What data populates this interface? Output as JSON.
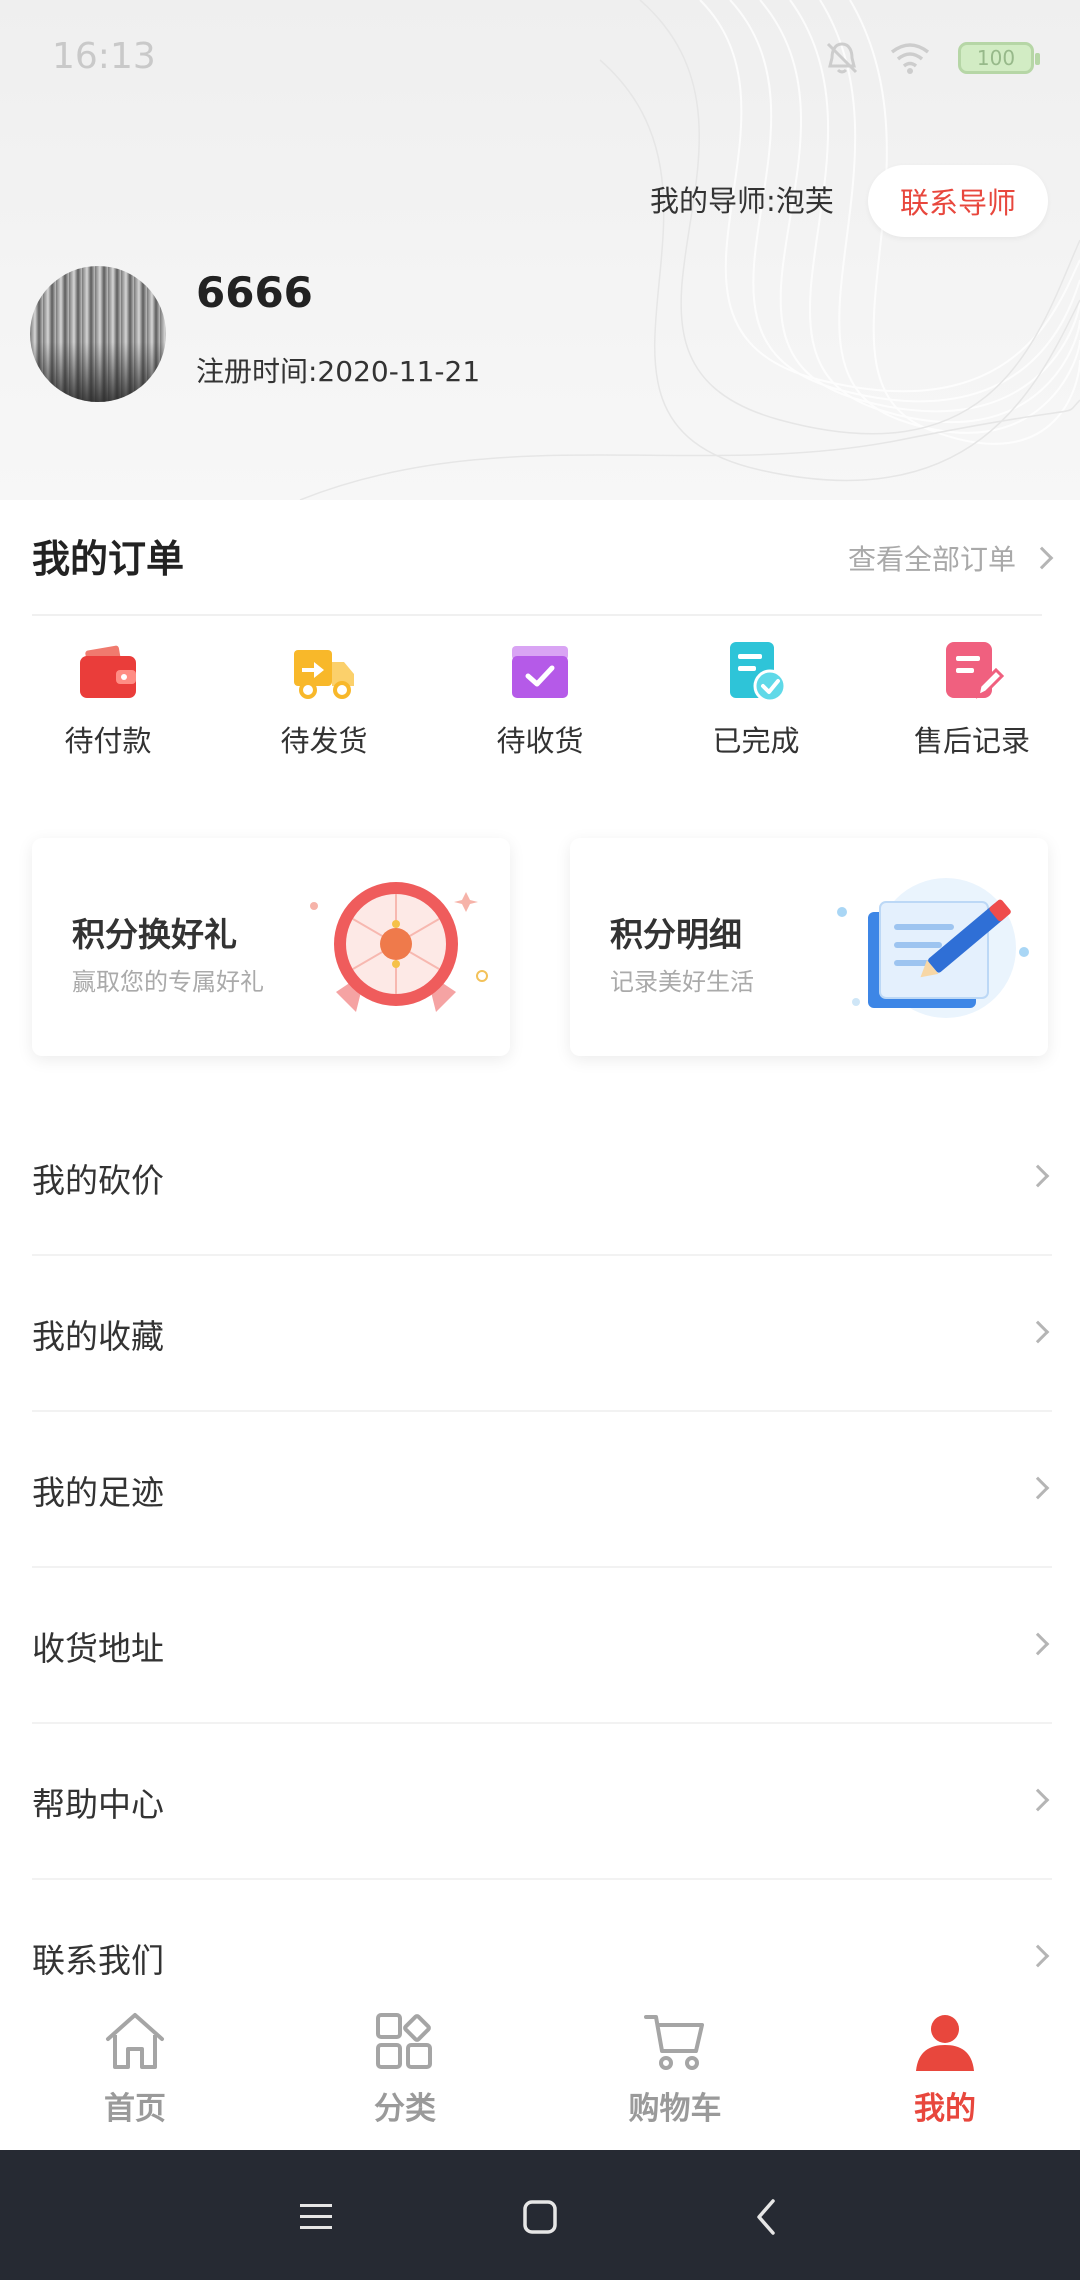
{
  "status_bar": {
    "time": "16:13",
    "battery": "100",
    "icons": [
      "mute-icon",
      "wifi-icon",
      "battery-icon"
    ]
  },
  "profile": {
    "mentor_text": "我的导师:泡芙",
    "contact_button": "联系导师",
    "username": "6666",
    "register_date": "注册时间:2020-11-21"
  },
  "orders": {
    "title": "我的订单",
    "view_all": "查看全部订单",
    "items": [
      {
        "label": "待付款",
        "icon": "wallet-icon"
      },
      {
        "label": "待发货",
        "icon": "truck-icon"
      },
      {
        "label": "待收货",
        "icon": "box-icon"
      },
      {
        "label": "已完成",
        "icon": "document-check-icon"
      },
      {
        "label": "售后记录",
        "icon": "note-edit-icon"
      }
    ]
  },
  "cards": [
    {
      "title": "积分换好礼",
      "subtitle": "赢取您的专属好礼",
      "icon": "prize-wheel-icon"
    },
    {
      "title": "积分明细",
      "subtitle": "记录美好生活",
      "icon": "notebook-pencil-icon"
    }
  ],
  "menu": [
    {
      "label": "我的砍价"
    },
    {
      "label": "我的收藏"
    },
    {
      "label": "我的足迹"
    },
    {
      "label": "收货地址"
    },
    {
      "label": "帮助中心"
    },
    {
      "label": "联系我们"
    }
  ],
  "tabbar": {
    "items": [
      {
        "label": "首页",
        "icon": "home-icon",
        "active": false
      },
      {
        "label": "分类",
        "icon": "category-icon",
        "active": false
      },
      {
        "label": "购物车",
        "icon": "cart-icon",
        "active": false
      },
      {
        "label": "我的",
        "icon": "user-icon",
        "active": true
      }
    ]
  },
  "colors": {
    "accent": "#e8473d",
    "inactive": "#9a9a9a"
  }
}
